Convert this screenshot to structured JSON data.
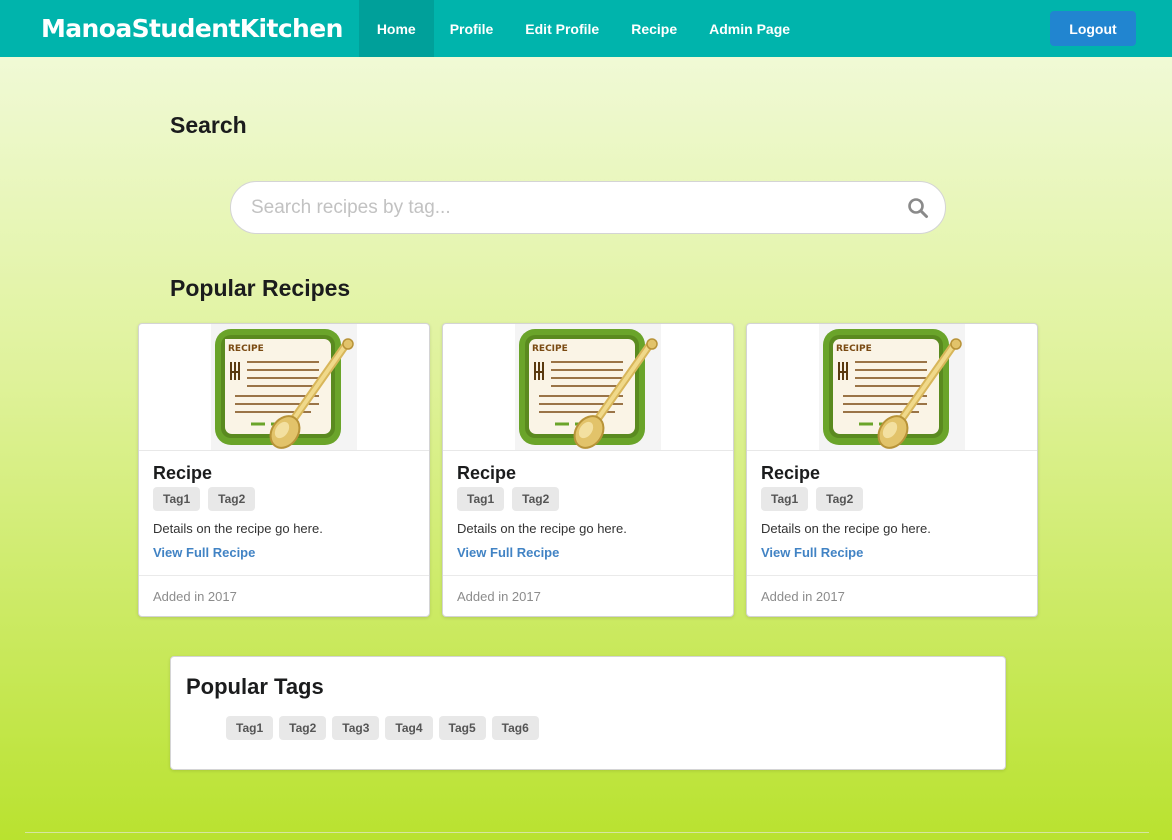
{
  "navbar": {
    "brand": "ManoaStudentKitchen",
    "items": [
      {
        "label": "Home",
        "active": true
      },
      {
        "label": "Profile"
      },
      {
        "label": "Edit Profile"
      },
      {
        "label": "Recipe"
      },
      {
        "label": "Admin Page"
      }
    ],
    "logout_label": "Logout",
    "color": "#00b4ac"
  },
  "search": {
    "heading": "Search",
    "placeholder": "Search recipes by tag...",
    "icon": "search-icon"
  },
  "popular_recipes": {
    "heading": "Popular Recipes",
    "cards": [
      {
        "title": "Recipe",
        "tags": [
          "Tag1",
          "Tag2"
        ],
        "description": "Details on the recipe go here.",
        "link": "View Full Recipe",
        "added": "Added in 2017",
        "image_text": "RECIPE"
      },
      {
        "title": "Recipe",
        "tags": [
          "Tag1",
          "Tag2"
        ],
        "description": "Details on the recipe go here.",
        "link": "View Full Recipe",
        "added": "Added in 2017",
        "image_text": "RECIPE"
      },
      {
        "title": "Recipe",
        "tags": [
          "Tag1",
          "Tag2"
        ],
        "description": "Details on the recipe go here.",
        "link": "View Full Recipe",
        "added": "Added in 2017",
        "image_text": "RECIPE"
      }
    ]
  },
  "popular_tags": {
    "heading": "Popular Tags",
    "tags": [
      "Tag1",
      "Tag2",
      "Tag3",
      "Tag4",
      "Tag5",
      "Tag6"
    ]
  }
}
